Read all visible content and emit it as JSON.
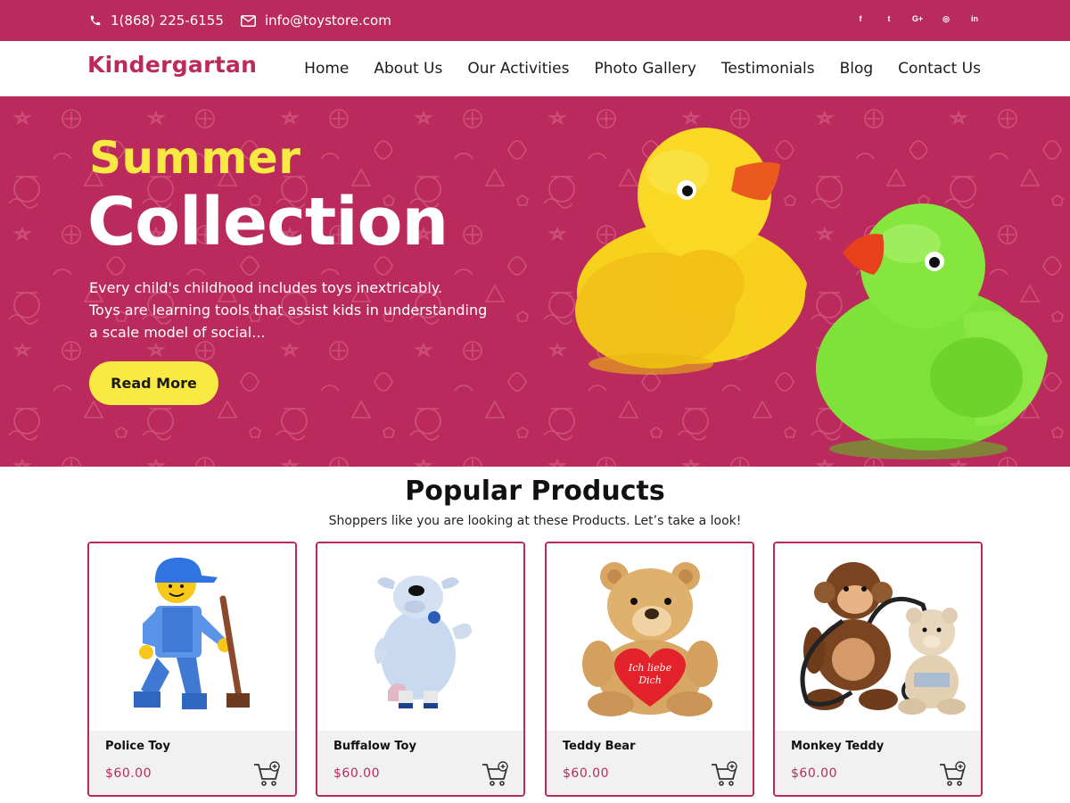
{
  "topbar": {
    "phone": "1(868) 225-6155",
    "email": "info@toystore.com",
    "social": [
      {
        "name": "facebook-icon",
        "glyph": "f"
      },
      {
        "name": "twitter-icon",
        "glyph": "t"
      },
      {
        "name": "google-plus-icon",
        "glyph": "G+"
      },
      {
        "name": "instagram-icon",
        "glyph": "◎"
      },
      {
        "name": "linkedin-icon",
        "glyph": "in"
      }
    ]
  },
  "brand": {
    "logo": "Kindergartan",
    "accent": "#bb2a5c",
    "highlight": "#f9ea43"
  },
  "nav": {
    "items": [
      "Home",
      "About Us",
      "Our Activities",
      "Photo Gallery",
      "Testimonials",
      "Blog",
      "Contact Us"
    ]
  },
  "hero": {
    "title_line1": "Summer",
    "title_line2": "Collection",
    "desc_lines": [
      "Every child's childhood includes toys inextricably.",
      "Toys are learning tools that assist kids in understanding",
      "a scale model of social..."
    ],
    "button": "Read More"
  },
  "products": {
    "title": "Popular Products",
    "subtitle": "Shoppers like you are looking at these Products. Let’s take a look!",
    "items": [
      {
        "name": "Police Toy",
        "price": "$60.00"
      },
      {
        "name": "Buffalow Toy",
        "price": "$60.00"
      },
      {
        "name": "Teddy Bear",
        "price": "$60.00"
      },
      {
        "name": "Monkey Teddy",
        "price": "$60.00"
      }
    ]
  }
}
